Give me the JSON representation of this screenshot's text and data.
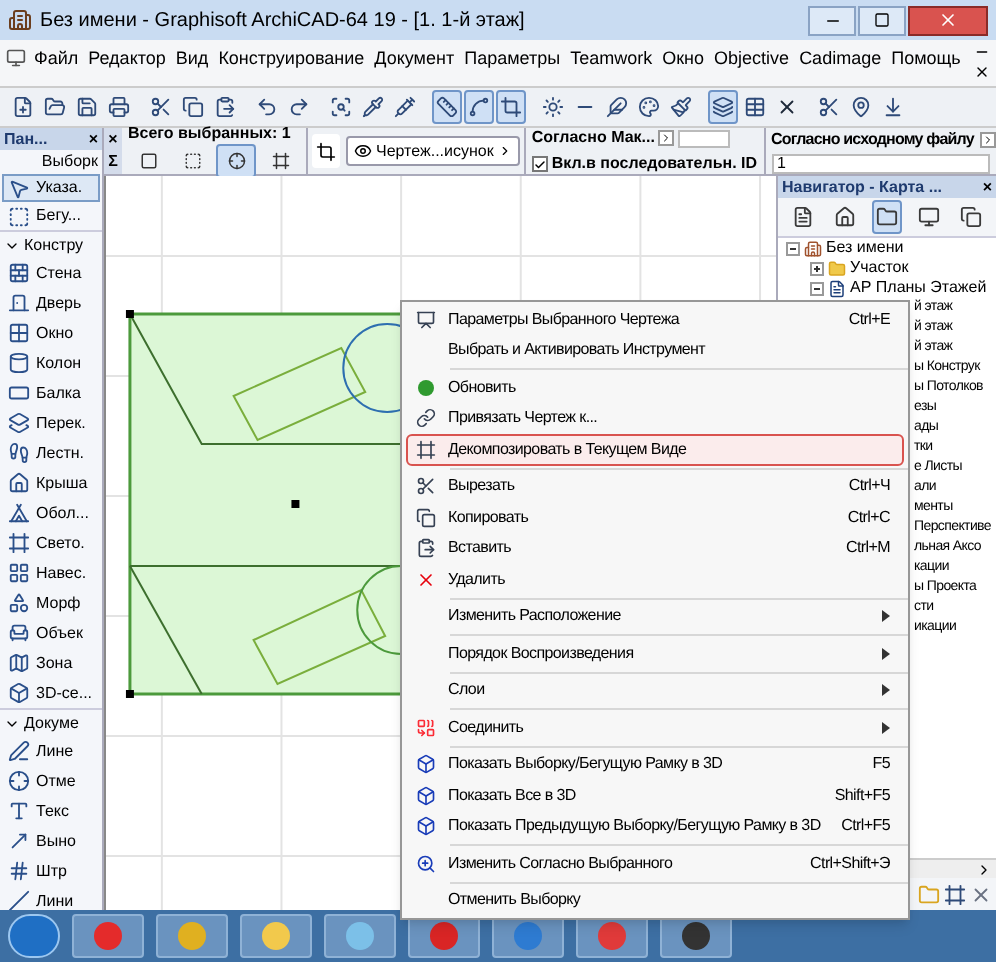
{
  "window": {
    "title": "Без имени - Graphisoft ArchiCAD-64 19 - [1. 1-й этаж]"
  },
  "menu_bar": [
    "Файл",
    "Редактор",
    "Вид",
    "Конструирование",
    "Документ",
    "Параметры",
    "Teamwork",
    "Окно",
    "Objective",
    "Cadimage",
    "Помощь"
  ],
  "toolbar": [
    {
      "pressed": false
    },
    {
      "pressed": false
    },
    {
      "pressed": false
    },
    {
      "pressed": false
    },
    {
      "pressed": false
    },
    {
      "pressed": false
    },
    {
      "pressed": false
    },
    {
      "pressed": false
    },
    {
      "pressed": false
    },
    {
      "pressed": false
    },
    {
      "pressed": false
    },
    {
      "pressed": false
    },
    {
      "pressed": true
    },
    {
      "pressed": true
    },
    {
      "pressed": true
    },
    {
      "pressed": false
    },
    {
      "pressed": false
    },
    {
      "pressed": false
    },
    {
      "pressed": false
    },
    {
      "pressed": false
    },
    {
      "pressed": true
    },
    {
      "pressed": false
    },
    {
      "pressed": false
    },
    {
      "pressed": false
    },
    {
      "pressed": false
    },
    {
      "pressed": false
    }
  ],
  "toolbox": {
    "title": "Пан...",
    "close": "×",
    "tab": "Выборк",
    "tools": [
      {
        "label": "Указа.",
        "selected": true
      },
      {
        "label": "Бегу...",
        "selected": false
      }
    ],
    "groups": [
      {
        "label": "Констру",
        "expanded": true,
        "tools": [
          {
            "label": "Стена",
            "selected": false
          },
          {
            "label": "Дверь",
            "selected": false
          },
          {
            "label": "Окно",
            "selected": false
          },
          {
            "label": "Колон",
            "selected": false
          },
          {
            "label": "Балка",
            "selected": false
          },
          {
            "label": "Перек.",
            "selected": false
          },
          {
            "label": "Лестн.",
            "selected": false
          },
          {
            "label": "Крыша",
            "selected": false
          },
          {
            "label": "Обол...",
            "selected": false
          },
          {
            "label": "Свето.",
            "selected": false
          },
          {
            "label": "Навес.",
            "selected": false
          },
          {
            "label": "Морф",
            "selected": false
          },
          {
            "label": "Объек",
            "selected": false
          },
          {
            "label": "Зона",
            "selected": false
          },
          {
            "label": "3D-се...",
            "selected": false
          }
        ]
      },
      {
        "label": "Докуме",
        "expanded": true,
        "tools": [
          {
            "label": "Лине",
            "selected": false
          },
          {
            "label": "Отме",
            "selected": false
          },
          {
            "label": "Текс",
            "selected": false
          },
          {
            "label": "Выно",
            "selected": false
          },
          {
            "label": "Штр",
            "selected": false
          },
          {
            "label": "Лини",
            "selected": false
          }
        ]
      }
    ]
  },
  "info_box": {
    "close": "×",
    "sum": "Σ",
    "selection": "Всего выбранных: 1",
    "buttons": [
      {
        "pressed": false
      },
      {
        "pressed": false
      },
      {
        "pressed": true
      },
      {
        "pressed": false
      },
      {
        "pressed": false
      }
    ],
    "view_button": "Чертеж...исунок",
    "scale_label": "Согласно Мак...",
    "id_checkbox": {
      "label": "Вкл.в последовательн. ID",
      "checked": true
    },
    "source_label": "Согласно исходному файлу",
    "source_value": "1"
  },
  "navigator": {
    "title": "Навигатор - Карта ...",
    "close": "×",
    "buttons": [
      {
        "pressed": false
      },
      {
        "pressed": false
      },
      {
        "pressed": true
      },
      {
        "pressed": false
      },
      {
        "pressed": false
      }
    ],
    "tree": [
      {
        "label": "Без имени",
        "expanded": true,
        "children": [
          {
            "label": "Участок",
            "expanded": false
          },
          {
            "label": "АР Планы Этажей",
            "expanded": true,
            "children": [
              {
                "label": "й этаж"
              },
              {
                "label": "й этаж"
              },
              {
                "label": "й этаж"
              },
              {
                "label": "ы Конструк"
              },
              {
                "label": "ы Потолков"
              },
              {
                "label": "езы"
              },
              {
                "label": "ады"
              },
              {
                "label": "тки"
              },
              {
                "label": "е Листы"
              },
              {
                "label": "али"
              },
              {
                "label": "менты"
              },
              {
                "label": "Перспективе"
              },
              {
                "label": "льная Аксо"
              },
              {
                "label": "кации"
              },
              {
                "label": "ы Проекта"
              },
              {
                "label": "сти"
              },
              {
                "label": "икации"
              }
            ]
          }
        ]
      }
    ]
  },
  "context_menu": {
    "items": [
      {
        "kind": "item",
        "label": "Параметры Выбранного Чертежа",
        "shortcut": "Ctrl+E",
        "selected": false
      },
      {
        "kind": "item",
        "label": "Выбрать и Активировать Инструмент",
        "selected": false
      },
      {
        "kind": "separator"
      },
      {
        "kind": "item",
        "label": "Обновить",
        "selected": false
      },
      {
        "kind": "item",
        "label": "Привязать Чертеж к...",
        "selected": false
      },
      {
        "kind": "item",
        "label": "Декомпозировать в Текущем Виде",
        "selected": true
      },
      {
        "kind": "separator"
      },
      {
        "kind": "item",
        "label": "Вырезать",
        "shortcut": "Ctrl+Ч",
        "selected": false
      },
      {
        "kind": "item",
        "label": "Копировать",
        "shortcut": "Ctrl+C",
        "selected": false
      },
      {
        "kind": "item",
        "label": "Вставить",
        "shortcut": "Ctrl+M",
        "selected": false
      },
      {
        "kind": "item",
        "label": "Удалить",
        "selected": false
      },
      {
        "kind": "separator"
      },
      {
        "kind": "submenu",
        "label": "Изменить Расположение",
        "selected": false
      },
      {
        "kind": "separator"
      },
      {
        "kind": "submenu",
        "label": "Порядок Воспроизведения",
        "selected": false
      },
      {
        "kind": "separator"
      },
      {
        "kind": "submenu",
        "label": "Слои",
        "selected": false
      },
      {
        "kind": "separator"
      },
      {
        "kind": "submenu",
        "label": "Соединить",
        "selected": false
      },
      {
        "kind": "separator"
      },
      {
        "kind": "item",
        "label": "Показать Выборку/Бегущую Рамку в 3D",
        "shortcut": "F5",
        "selected": false
      },
      {
        "kind": "item",
        "label": "Показать Все в 3D",
        "shortcut": "Shift+F5",
        "selected": false
      },
      {
        "kind": "item",
        "label": "Показать Предыдущую Выборку/Бегущую Рамку в 3D",
        "shortcut": "Ctrl+F5",
        "selected": false
      },
      {
        "kind": "separator"
      },
      {
        "kind": "item",
        "label": "Изменить Согласно Выбранного",
        "shortcut": "Ctrl+Shift+Э",
        "selected": false
      },
      {
        "kind": "separator"
      },
      {
        "kind": "item",
        "label": "Отменить Выборку",
        "selected": false
      }
    ]
  }
}
